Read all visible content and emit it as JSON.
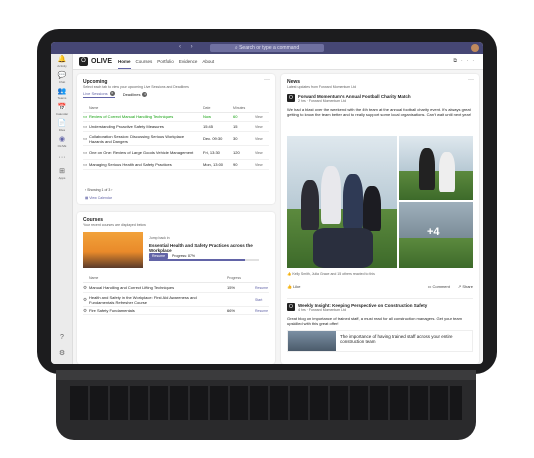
{
  "topbar": {
    "search_placeholder": "Search or type a command"
  },
  "rail": [
    {
      "icon": "bell-icon",
      "glyph": "🔔",
      "label": "Activity"
    },
    {
      "icon": "chat-icon",
      "glyph": "💬",
      "label": "Chat"
    },
    {
      "icon": "teams-icon",
      "glyph": "👥",
      "label": "Teams"
    },
    {
      "icon": "calendar-icon",
      "glyph": "📅",
      "label": "Calendar"
    },
    {
      "icon": "files-icon",
      "glyph": "📄",
      "label": "Files"
    },
    {
      "icon": "olive-icon",
      "glyph": "◉",
      "label": "OLIVE"
    },
    {
      "icon": "more-icon",
      "glyph": "···",
      "label": ""
    },
    {
      "icon": "apps-icon",
      "glyph": "⊞",
      "label": "Apps"
    }
  ],
  "rail_bottom": [
    {
      "icon": "help-icon",
      "glyph": "?",
      "label": ""
    },
    {
      "icon": "settings-icon",
      "glyph": "⚙",
      "label": ""
    }
  ],
  "app": {
    "logo": "O",
    "name": "OLIVE",
    "tabs": [
      "Home",
      "Courses",
      "Portfolio",
      "Evidence",
      "About"
    ],
    "active_tab": "Home"
  },
  "upcoming": {
    "title": "Upcoming",
    "subtitle": "Select each tab to view your upcoming Live Sessions and Deadlines",
    "tabs": [
      {
        "label": "Live Sessions",
        "count": "6"
      },
      {
        "label": "Deadlines",
        "count": "4"
      }
    ],
    "columns": [
      "Name",
      "Date",
      "Minutes"
    ],
    "rows": [
      {
        "name": "Review of Correct Manual Handling Techniques",
        "date": "Now",
        "mins": "60",
        "action": "View",
        "highlight": true
      },
      {
        "name": "Understanding Proactive Safety Measures",
        "date": "15:45",
        "mins": "15",
        "action": "View",
        "highlight": false
      },
      {
        "name": "Collaboration Session: Discussing Serious Workplace Hazards and Dangers",
        "date": "Dec. 09:30",
        "mins": "30",
        "action": "View",
        "highlight": false
      },
      {
        "name": "One on One: Review of Large Goods Vehicle Management",
        "date": "Fri, 13:30",
        "mins": "120",
        "action": "View",
        "highlight": false
      },
      {
        "name": "Managing Serious Health and Safety Practices",
        "date": "Mon, 13:00",
        "mins": "90",
        "action": "View",
        "highlight": false
      }
    ],
    "showing": "Showing 1 of 3",
    "view_calendar": "View Calendar"
  },
  "courses": {
    "title": "Courses",
    "subtitle": "Your recent courses are displayed below",
    "jump_label": "Jump back in",
    "featured_title": "Essential Health and Safety Practices across the Workplace",
    "resume_label": "Resume",
    "progress_text": "Progress: 87%",
    "progress": 0.87,
    "columns": [
      "Name",
      "Progress"
    ],
    "rows": [
      {
        "name": "Manual Handling and Correct Lifting Techniques",
        "progress": "15%",
        "action": "Resume"
      },
      {
        "name": "Health and Safety in the Workplace: First Aid Awareness and Fundamentals Refresher Course",
        "progress": "",
        "action": "Start"
      },
      {
        "name": "Fire Safety Fundamentals",
        "progress": "66%",
        "action": "Resume"
      }
    ]
  },
  "news": {
    "title": "News",
    "subtitle": "Latest updates from Forward Momentum Ltd",
    "posts": [
      {
        "title": "Forward Momentum's Annual Football Charity Match",
        "time": "2 hrs · Forward Momentum Ltd",
        "text": "We had a blast over the weekend with the 4th team at the annual football charity event. It's always great getting to know the team better and to really support some local organisations. Can't wait until next year!",
        "more_photos": "+4",
        "reactions": "Kelly Smith, Julia Grace and 15 others reacted to this",
        "actions": [
          "Like",
          "Comment",
          "Share"
        ]
      },
      {
        "title": "Weekly Insight: Keeping Perspective on Construction Safety",
        "time": "4 hrs · Forward Momentum Ltd",
        "text": "Great blog on importance of trained staff, a must read for all construction managers. Get your team upskilled with this great offer!",
        "link_title": "The importance of having trained staff across your entire construction team"
      }
    ]
  },
  "colors": {
    "accent": "#6264a7",
    "header": "#464775",
    "live": "#13a10e"
  }
}
